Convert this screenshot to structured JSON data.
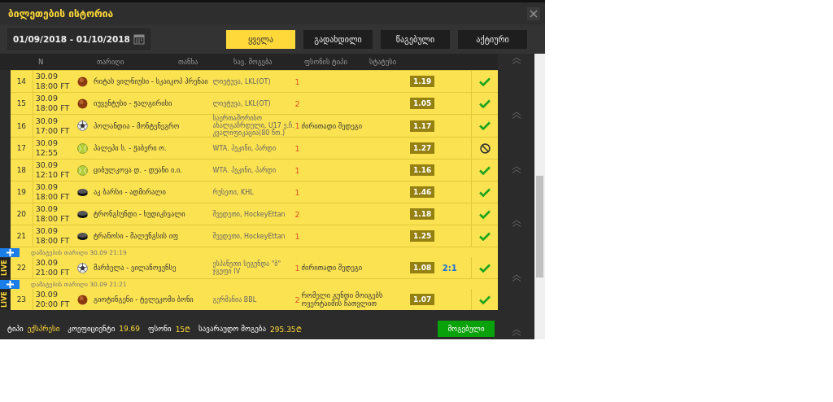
{
  "window": {
    "title": "ბილეთების ისტორია"
  },
  "date_range": "01/09/2018 - 01/10/2018",
  "filters": [
    {
      "label": "ყველა",
      "selected": true
    },
    {
      "label": "გადახდილი",
      "selected": false
    },
    {
      "label": "წაგებული",
      "selected": false
    },
    {
      "label": "აქტიური",
      "selected": false
    }
  ],
  "columns": [
    "N",
    "თარიღი",
    "თანხა",
    "სავ. მოგება",
    "ფსონის ტიპი",
    "სტატუსი"
  ],
  "rows": [
    {
      "n": "14",
      "date": "30.09",
      "time": "18:00 FT",
      "kind": "basketball",
      "match": "რიტას ვილნიუსი - სკაიკოპ პრენაი",
      "league": "ლიეტუვა, LKL(OT)",
      "pick": "1",
      "odds": "1.19",
      "void": false,
      "live": false
    },
    {
      "n": "15",
      "date": "30.09",
      "time": "18:00 FT",
      "kind": "basketball",
      "match": "იუვენტუსი - ჟალგირისი",
      "league": "ლიეტუვა, LKL(OT)",
      "pick": "2",
      "odds": "1.05",
      "void": false,
      "live": false
    },
    {
      "n": "16",
      "date": "30.09",
      "time": "17:00 FT",
      "kind": "football",
      "match": "პოლანდია - მონტენეგრო",
      "league": "საერთაშორისო ახალგაზრდული, U17 ე.ჩ. კვალიფიკაცია(80 წთ.)",
      "pick": "1",
      "market": "ძირითადი შედეგი",
      "odds": "1.17",
      "void": false,
      "live": false
    },
    {
      "n": "17",
      "date": "30.09",
      "time": "12:55",
      "kind": "tennis",
      "match": "პალეპი ს. - ჟაბერი ო.",
      "league": "WTA. პეკინი, პარდი",
      "pick": "1",
      "odds": "1.27",
      "void": true,
      "live": false
    },
    {
      "n": "18",
      "date": "30.09",
      "time": "12:10 FT",
      "kind": "tennis",
      "match": "ციბულკოვა დ. - დუანი ი.ი.",
      "league": "WTA. პეკინი, პარდი",
      "pick": "1",
      "odds": "1.16",
      "void": false,
      "live": false
    },
    {
      "n": "19",
      "date": "30.09",
      "time": "18:00 FT",
      "kind": "hockey",
      "match": "აკ ბარსი - ადმირალი",
      "league": "რუსეთი, KHL",
      "pick": "1",
      "odds": "1.46",
      "void": false,
      "live": false
    },
    {
      "n": "20",
      "date": "30.09",
      "time": "18:00 FT",
      "kind": "hockey",
      "match": "ტრონგსუნდი - ხუდიკსვალი",
      "league": "შვედეთი, HockeyEttan",
      "pick": "2",
      "odds": "1.18",
      "void": false,
      "live": false
    },
    {
      "n": "21",
      "date": "30.09",
      "time": "18:00 FT",
      "kind": "hockey",
      "match": "ტრანოსი - მალუნგსის იფ",
      "league": "შვედეთი, HockeyEttan",
      "pick": "1",
      "odds": "1.25",
      "void": false,
      "live": false
    },
    {
      "n": "22",
      "added": "დამატების თარიღი 30.09 21:19",
      "live_badge": "LIVE",
      "date": "30.09",
      "time": "21:00 FT",
      "kind": "football",
      "match": "მარბელა - ვილანოვენსე",
      "league": "ესპანეთი სეგუნდა \"ბ\" ჯგუფი IV",
      "pick": "1",
      "market": "ძირითადი შედეგი",
      "odds": "1.08",
      "score": "2:1",
      "void": false,
      "live": true
    },
    {
      "n": "23",
      "added": "დამატების თარიღი 30.09 21:21",
      "live_badge": "LIVE",
      "date": "30.09",
      "time": "20:00 FT",
      "kind": "basketball",
      "match": "გიოტინგენი - ტელეკომი ბონი",
      "league": "გერმანია BBL",
      "pick": "2",
      "market": "რომელი გუნდი მოიგებს ოვერტაიმის ჩათვლით",
      "odds": "1.07",
      "void": false,
      "live": true
    }
  ],
  "footer": {
    "type_label": "ტიპი",
    "type": "ექსპრესი",
    "odds_label": "კოეფიციენტი",
    "odds": "19.69",
    "stake_label": "ფსონი",
    "stake": "15₾",
    "win_label": "სავარაუდო მოგება",
    "win": "295.35₾",
    "status_button": "მოგებული"
  }
}
